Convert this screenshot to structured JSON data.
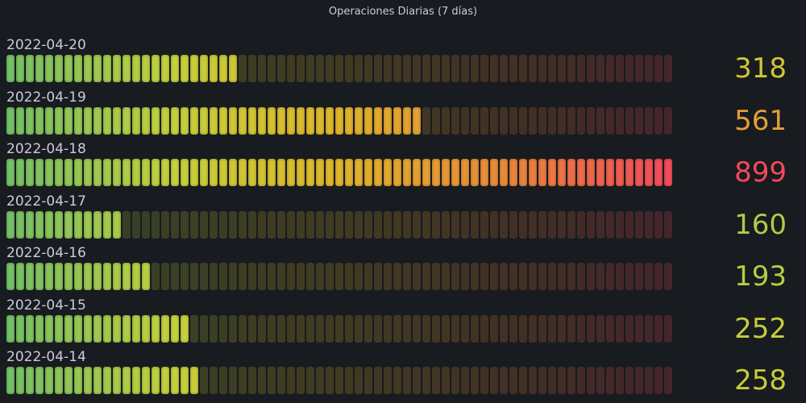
{
  "panel": {
    "title": "Operaciones Diarias (7 días)"
  },
  "chart_data": {
    "type": "bar",
    "orientation": "horizontal",
    "style": "bar-gauge-lcd",
    "min": 0,
    "max": 900,
    "categories": [
      "2022-04-20",
      "2022-04-19",
      "2022-04-18",
      "2022-04-17",
      "2022-04-16",
      "2022-04-15",
      "2022-04-14"
    ],
    "values": [
      318,
      561,
      899,
      160,
      193,
      252,
      258
    ],
    "value_labels": [
      "318",
      "561",
      "899",
      "160",
      "193",
      "252",
      "258"
    ],
    "color_scale": [
      "#73bf69",
      "#c4d13b",
      "#e0b52c",
      "#e8883a",
      "#f2495c"
    ],
    "grid": false,
    "legend": "none"
  }
}
